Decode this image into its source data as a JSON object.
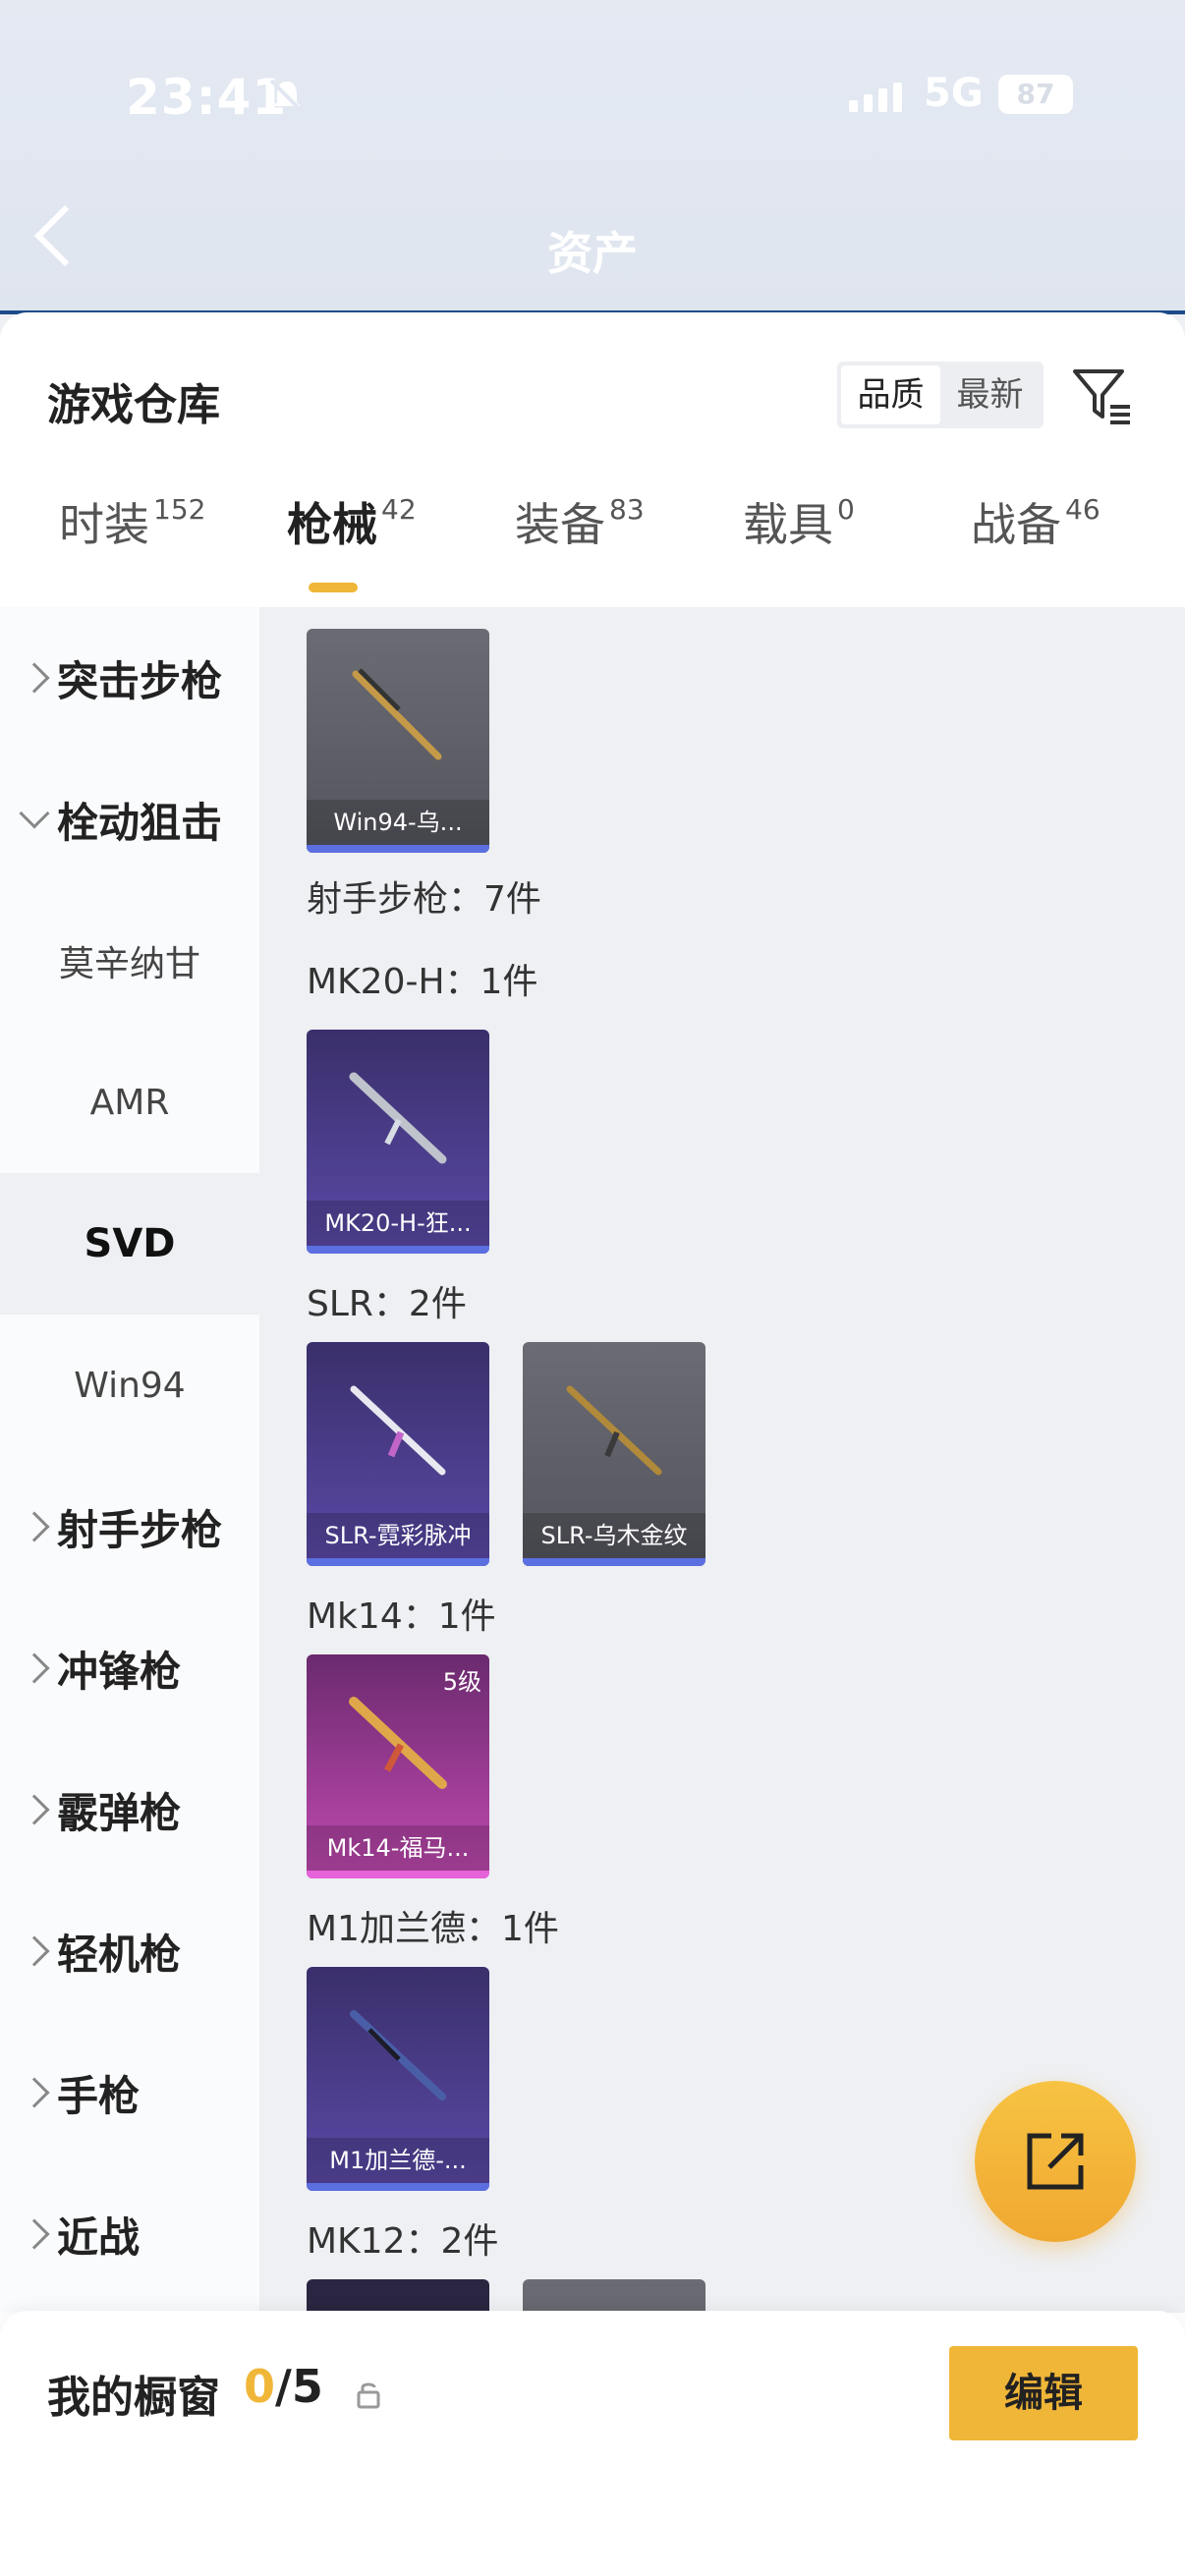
{
  "status_bar": {
    "time": "23:41",
    "network": "5G",
    "battery": "87"
  },
  "header": {
    "title": "资产"
  },
  "warehouse": {
    "title": "游戏仓库",
    "sort_options": [
      "品质",
      "最新"
    ],
    "tabs": [
      {
        "label": "时装",
        "count": "152"
      },
      {
        "label": "枪械",
        "count": "42"
      },
      {
        "label": "装备",
        "count": "83"
      },
      {
        "label": "载具",
        "count": "0"
      },
      {
        "label": "战备",
        "count": "46"
      }
    ]
  },
  "sidebar": {
    "items": [
      {
        "label": "突击步枪"
      },
      {
        "label": "栓动狙击"
      },
      {
        "label": "莫辛纳甘"
      },
      {
        "label": "AMR"
      },
      {
        "label": "SVD"
      },
      {
        "label": "Win94"
      },
      {
        "label": "射手步枪"
      },
      {
        "label": "冲锋枪"
      },
      {
        "label": "霰弹枪"
      },
      {
        "label": "轻机枪"
      },
      {
        "label": "手枪"
      },
      {
        "label": "近战"
      }
    ]
  },
  "content": {
    "cards": [
      {
        "name": "Win94-乌...",
        "level": ""
      },
      {
        "name": "MK20-H-狂...",
        "level": ""
      },
      {
        "name": "SLR-霓彩脉冲",
        "level": ""
      },
      {
        "name": "SLR-乌木金纹",
        "level": ""
      },
      {
        "name": "Mk14-福马...",
        "level": "5级"
      },
      {
        "name": "M1加兰德-...",
        "level": ""
      }
    ],
    "groups": [
      "射手步枪：7件",
      "MK20-H：1件",
      "SLR：2件",
      "Mk14：1件",
      "M1加兰德：1件",
      "MK12：2件"
    ]
  },
  "showcase": {
    "title": "我的橱窗",
    "current": "0",
    "total": "/5",
    "edit_label": "编辑"
  },
  "colors": {
    "accent": "#f0b638",
    "rare_bar": "#5b6fe0",
    "legend_bar": "#e562d8"
  }
}
